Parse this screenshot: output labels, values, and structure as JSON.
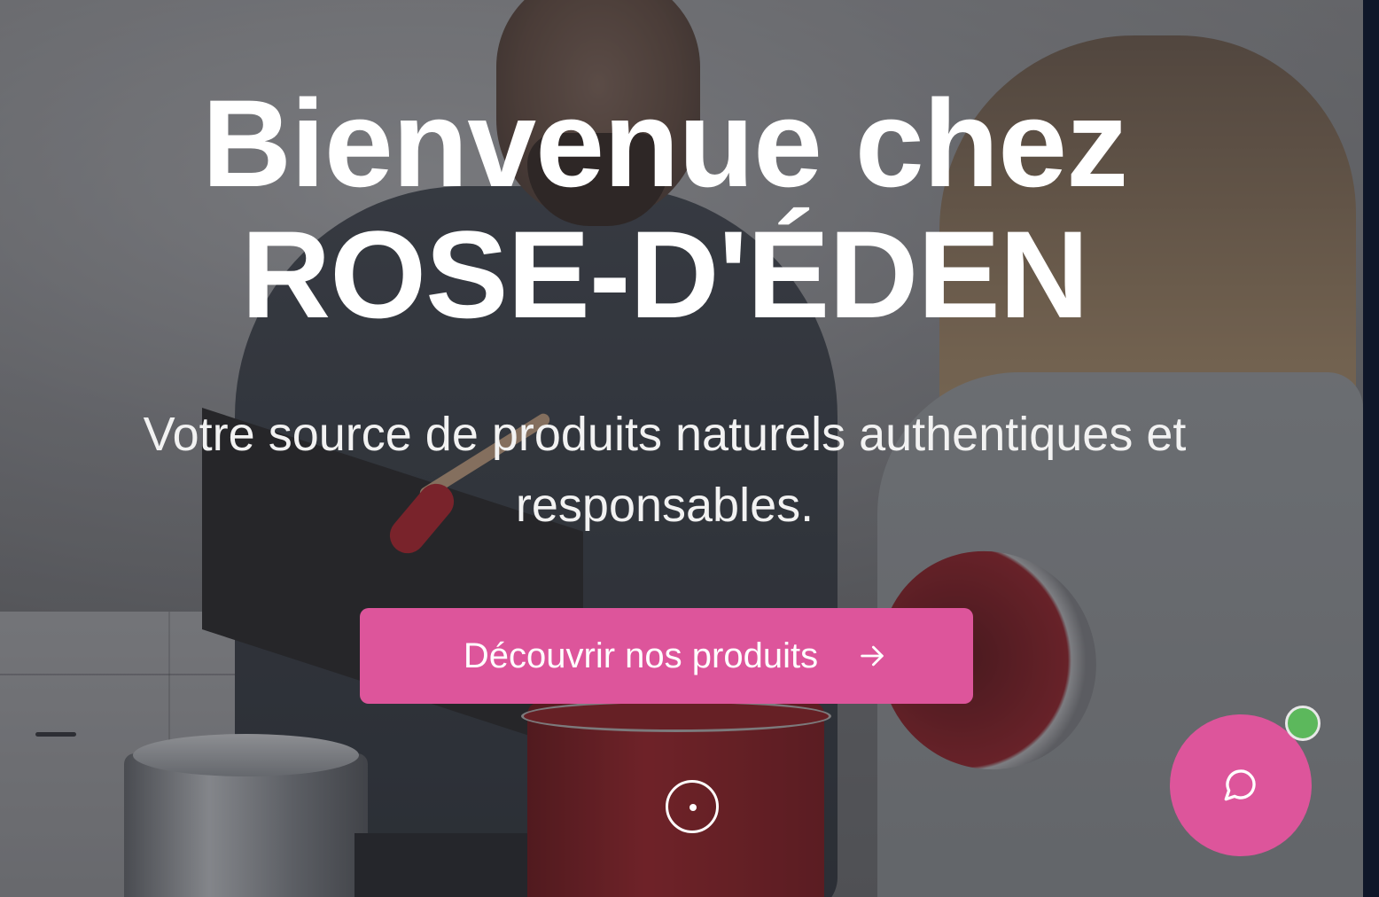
{
  "hero": {
    "title_line1": "Bienvenue chez",
    "title_line2": "ROSE-D'ÉDEN",
    "subtitle": "Votre source de produits naturels authentiques et responsables.",
    "cta_label": "Découvrir nos produits",
    "cta_icon": "arrow-right-icon",
    "scroll_icon": "scroll-indicator-icon"
  },
  "chat": {
    "icon": "chat-bubble-icon",
    "status": "online",
    "status_color": "#5cb85c"
  },
  "colors": {
    "accent": "#dd559b",
    "text": "#ffffff",
    "edge": "#0f1729"
  }
}
